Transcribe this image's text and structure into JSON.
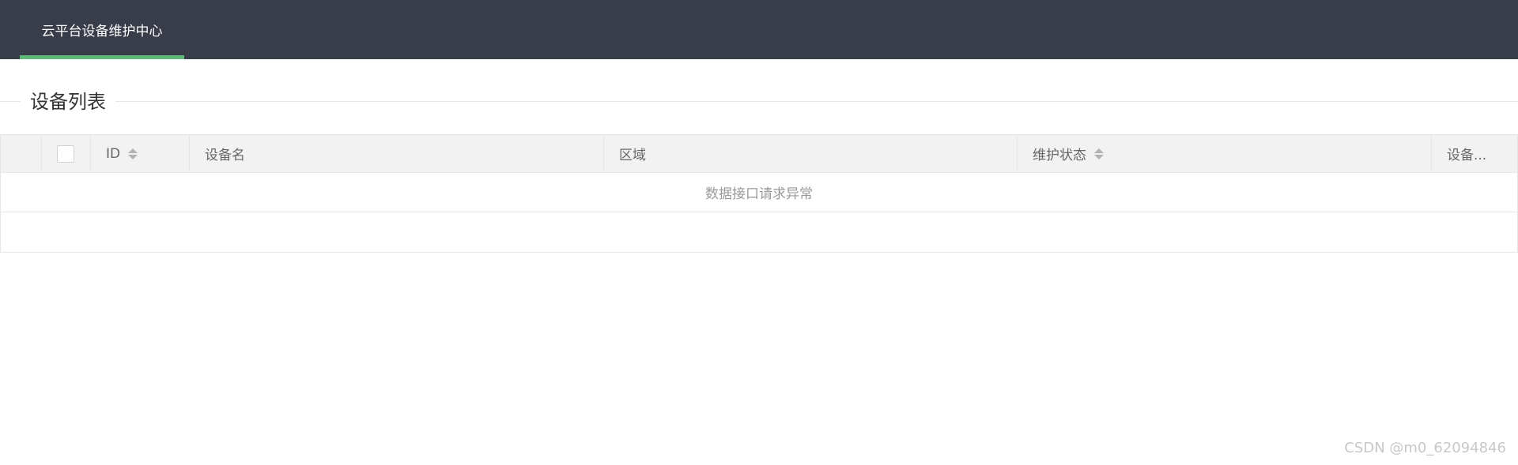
{
  "header": {
    "tab_label": "云平台设备维护中心",
    "accent_color": "#5fb878",
    "background_color": "#393d49"
  },
  "section": {
    "title": "设备列表"
  },
  "table": {
    "columns": [
      {
        "label": "",
        "kind": "index"
      },
      {
        "label": "",
        "kind": "checkbox"
      },
      {
        "label": "ID",
        "sortable": true
      },
      {
        "label": "设备名",
        "sortable": false
      },
      {
        "label": "区域",
        "sortable": false
      },
      {
        "label": "维护状态",
        "sortable": true
      },
      {
        "label": "设备...",
        "sortable": false
      }
    ],
    "empty_message": "数据接口请求异常"
  },
  "watermark": "CSDN @m0_62094846"
}
